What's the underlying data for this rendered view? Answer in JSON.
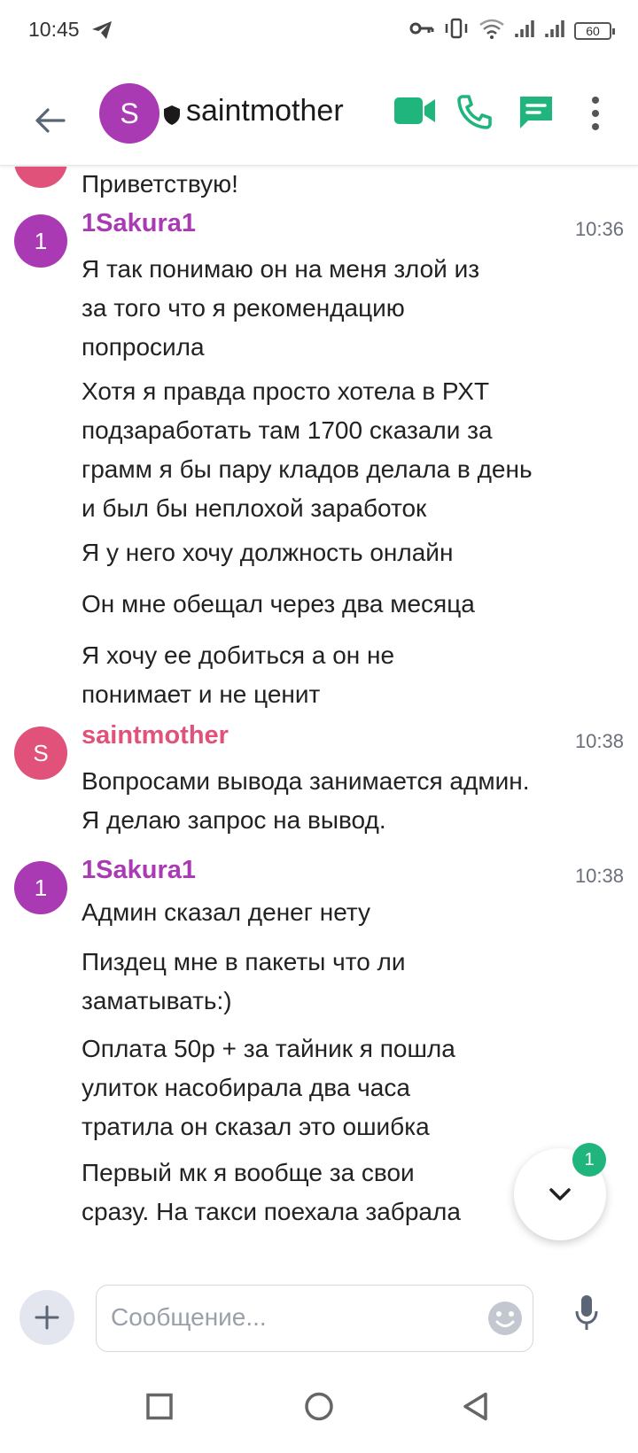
{
  "status_bar": {
    "time": "10:45",
    "battery": "60"
  },
  "header": {
    "avatar_letter": "S",
    "title": "saintmother"
  },
  "messages": {
    "partial_top": "Приветствую!",
    "group1": {
      "avatar_letter": "1",
      "sender": "1Sakura1",
      "time": "10:36",
      "lines": [
        "Я так понимаю он на меня злой из за того что я рекомендацию попросила",
        "Хотя я правда просто хотела в РХТ подзаработать там 1700 сказали за грамм я бы пару кладов делала в день и был бы неплохой заработок",
        "Я у него хочу должность онлайн",
        "Он мне обещал через два месяца",
        "Я хочу ее добиться а он не понимает и не ценит"
      ]
    },
    "group2": {
      "avatar_letter": "S",
      "sender": "saintmother",
      "time": "10:38",
      "lines": [
        "Вопросами вывода занимается админ. Я делаю  запрос на вывод."
      ]
    },
    "group3": {
      "avatar_letter": "1",
      "sender": "1Sakura1",
      "time": "10:38",
      "lines": [
        "Админ сказал денег нету",
        "Пиздец мне в пакеты что ли заматывать:)",
        "Оплата 50р + за тайник я пошла улиток насобирала два часа тратила он сказал это ошибка",
        "Первый мк я вообще за свои сразу. На такси поехала забрала"
      ]
    }
  },
  "scroll": {
    "unread_count": "1"
  },
  "composer": {
    "placeholder": "Сообщение..."
  }
}
